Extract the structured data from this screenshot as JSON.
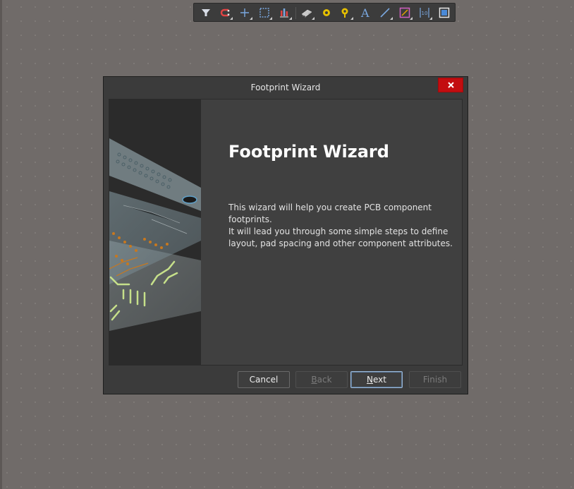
{
  "toolbar": {
    "buttons": [
      {
        "icon": "filter-icon"
      },
      {
        "icon": "snap-magnet-icon"
      },
      {
        "icon": "crosshair-icon"
      },
      {
        "icon": "select-rectangle-icon"
      },
      {
        "icon": "align-icon"
      },
      {
        "icon": "component-icon"
      },
      {
        "icon": "pad-icon"
      },
      {
        "icon": "via-icon"
      },
      {
        "icon": "text-icon"
      },
      {
        "icon": "line-icon"
      },
      {
        "icon": "graphic-icon"
      },
      {
        "icon": "dimension-icon"
      },
      {
        "icon": "fill-icon"
      }
    ],
    "text_glyph": "A",
    "dimension_glyph": "10"
  },
  "dialog": {
    "title": "Footprint Wizard",
    "heading": "Footprint Wizard",
    "description_1": "This wizard will help you create PCB component footprints.",
    "description_2": "It will lead you through some simple steps to define layout, pad spacing and other component attributes.",
    "buttons": {
      "cancel": "Cancel",
      "back_mnemonic": "B",
      "back_rest": "ack",
      "next_mnemonic": "N",
      "next_rest": "ext",
      "finish": "Finish"
    }
  },
  "colors": {
    "canvas": "#706b69",
    "dialog_bg": "#3b3b3b",
    "close_button": "#c30d10",
    "default_button_border": "#9bb8d8"
  }
}
